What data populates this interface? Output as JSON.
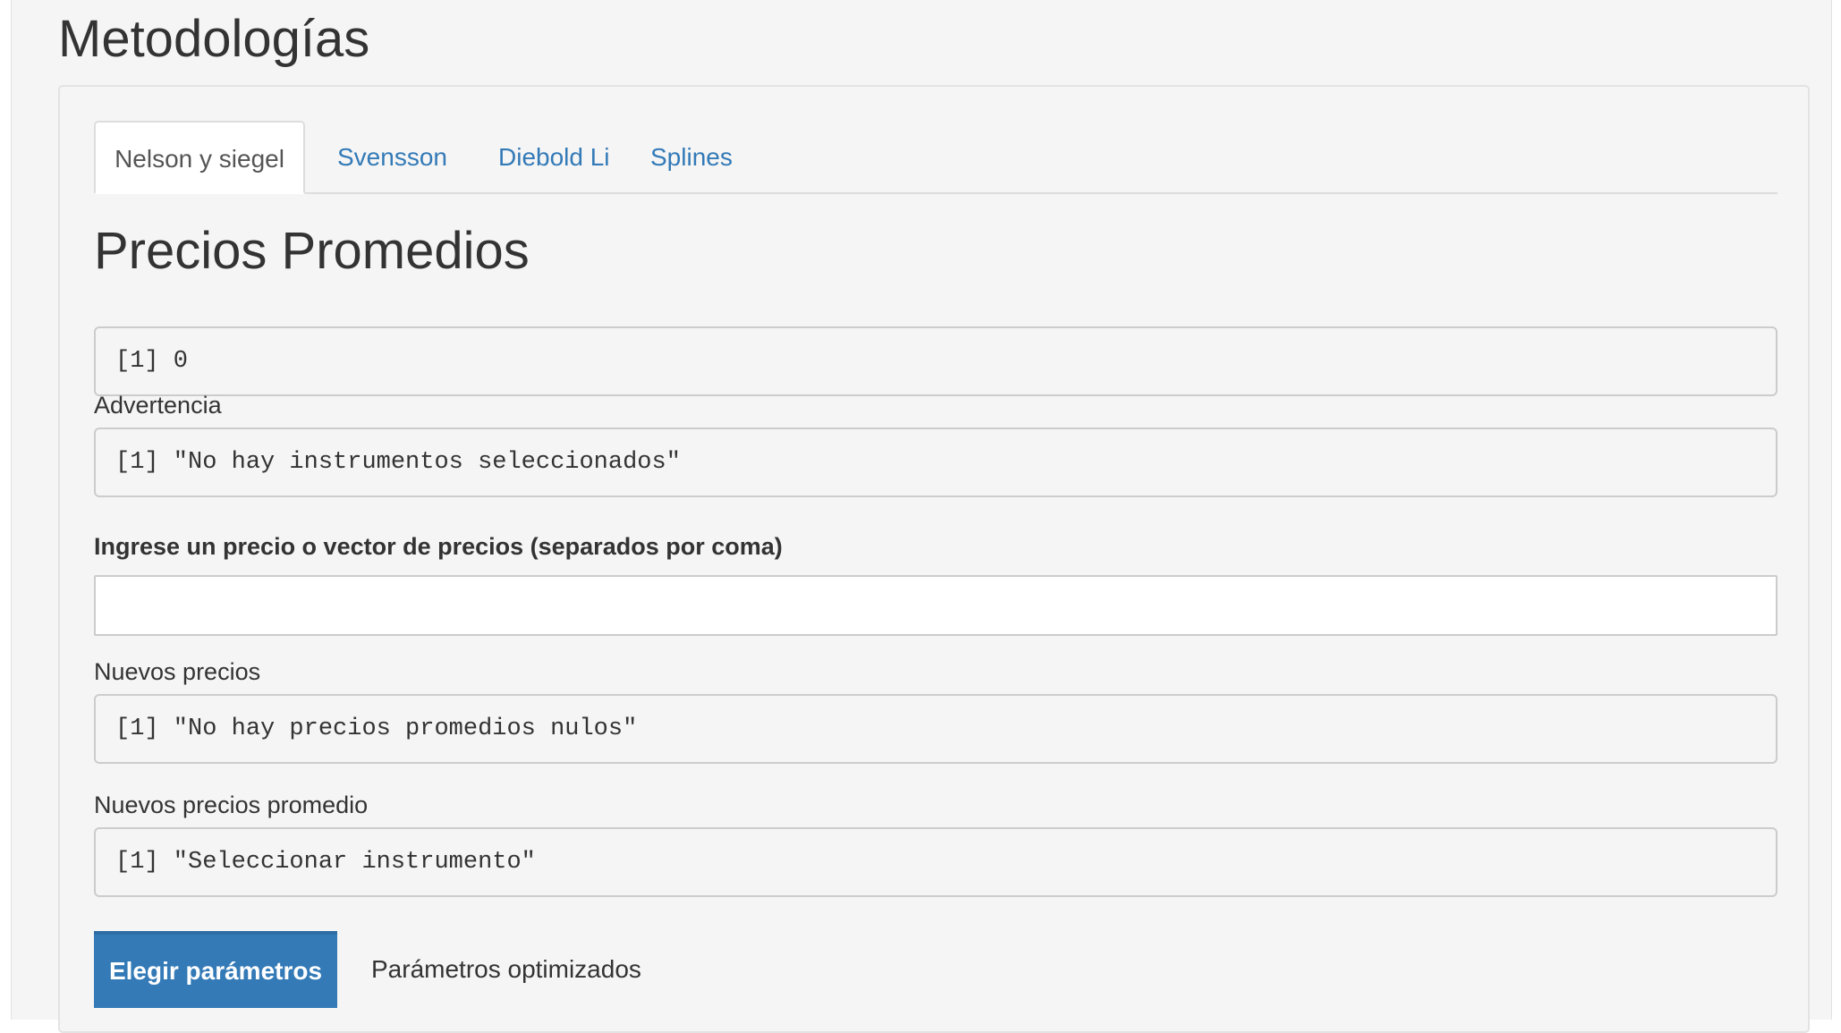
{
  "page": {
    "title": "Metodologías"
  },
  "tabs": [
    {
      "label": "Nelson y siegel",
      "active": true
    },
    {
      "label": "Svensson",
      "active": false
    },
    {
      "label": "Diebold Li",
      "active": false
    },
    {
      "label": "Splines",
      "active": false
    }
  ],
  "content": {
    "section_title": "Precios Promedios",
    "outputs": {
      "precios_promedios": "[1] 0",
      "advertencia": "[1] \"No hay instrumentos seleccionados\"",
      "nuevos_precios": "[1] \"No hay precios promedios nulos\"",
      "nuevos_precios_promedio": "[1] \"Seleccionar instrumento\""
    },
    "labels": {
      "advertencia": "Advertencia",
      "price_input": "Ingrese un precio o vector de precios (separados por coma)",
      "nuevos_precios": "Nuevos precios",
      "nuevos_precios_promedio": "Nuevos precios promedio"
    },
    "price_input": {
      "value": "",
      "placeholder": ""
    }
  },
  "actions": {
    "elegir_parametros": "Elegir parámetros",
    "parametros_optimizados": "Parámetros optimizados"
  },
  "colors": {
    "accent": "#337ab7",
    "background": "#f5f5f5",
    "text": "#333333",
    "border": "#cccccc"
  }
}
